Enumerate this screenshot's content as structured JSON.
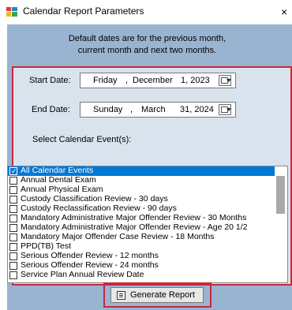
{
  "window": {
    "title": "Calendar Report Parameters",
    "close_glyph": "×",
    "app_icon": "app-icon"
  },
  "info": {
    "line1": "Default dates are for the previous month,",
    "line2": "current month and next two months."
  },
  "start": {
    "label": "Start Date:",
    "weekday": "Friday",
    "sep": ",",
    "month": "December",
    "date": "1, 2023"
  },
  "end": {
    "label": "End Date:",
    "weekday": "Sunday",
    "sep": ",",
    "month": "March",
    "date": "31, 2024"
  },
  "events": {
    "label": "Select Calendar Event(s):",
    "items": [
      {
        "label": "All Calendar Events",
        "checked": true,
        "selected": true
      },
      {
        "label": "Annual Dental Exam",
        "checked": false
      },
      {
        "label": "Annual Physical Exam",
        "checked": false
      },
      {
        "label": "Custody Classification Review - 30 days",
        "checked": false
      },
      {
        "label": "Custody Reclassification Review - 90 days",
        "checked": false
      },
      {
        "label": "Mandatory Administrative Major Offender Review - 30 Months",
        "checked": false
      },
      {
        "label": "Mandatory Administrative Major Offender Review - Age 20 1/2",
        "checked": false
      },
      {
        "label": "Mandatory Major Offender Case Review - 18 Months",
        "checked": false
      },
      {
        "label": "PPD(TB) Test",
        "checked": false
      },
      {
        "label": "Serious Offender Review - 12 months",
        "checked": false
      },
      {
        "label": "Serious Offender Review - 24 months",
        "checked": false
      },
      {
        "label": "Service Plan Annual Review Date",
        "checked": false
      }
    ]
  },
  "actions": {
    "generate_label": "Generate Report",
    "generate_icon": "report-icon"
  },
  "colors": {
    "client_bg": "#99b4d1",
    "highlight_frame": "#c8283c",
    "selection": "#0078d7"
  }
}
